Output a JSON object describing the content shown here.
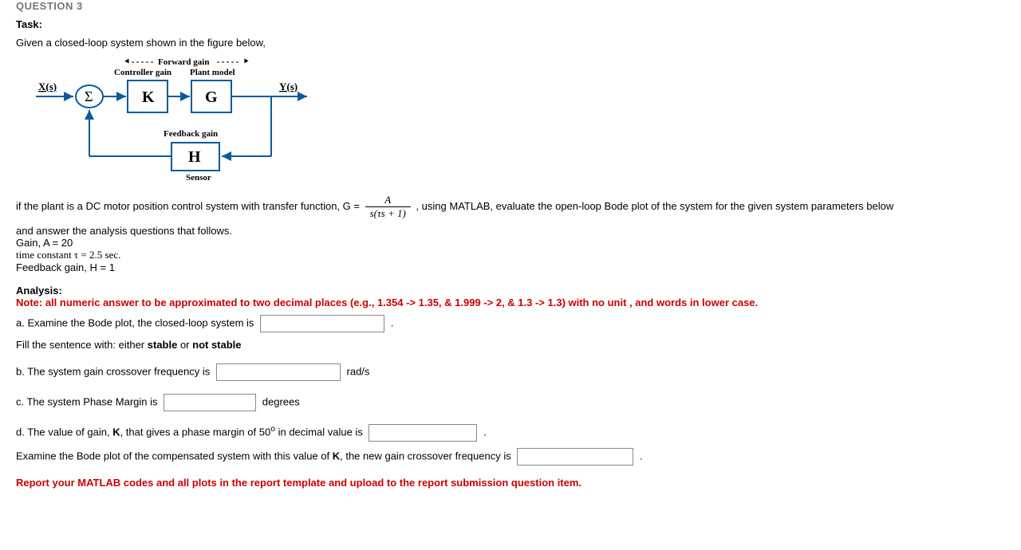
{
  "header": {
    "question_label": "QUESTION 3",
    "task_label": "Task:",
    "task_text": "Given a closed-loop system shown in the figure below,"
  },
  "diagram": {
    "forward_gain_label": "Forward gain",
    "controller_gain_label": "Controller gain",
    "plant_model_label": "Plant model",
    "feedback_gain_label": "Feedback gain",
    "sensor_label": "Sensor",
    "input_label": "X(s)",
    "output_label": "Y(s)",
    "sum_symbol": "Σ",
    "k_label": "K",
    "g_label": "G",
    "h_label": "H"
  },
  "transfer": {
    "pre_text": "if the plant is a DC motor position control system with  transfer function, G =",
    "numerator": "A",
    "denominator": "s(τs + 1)",
    "post_text": ",   using MATLAB, evaluate the open-loop Bode plot of the system for the given system parameters below"
  },
  "params": {
    "line1": "and  answer the analysis questions that follows.",
    "line2": "Gain, A = 20",
    "line3": "time constant τ = 2.5 sec.",
    "line4": "Feedback gain, H = 1"
  },
  "analysis": {
    "analysis_label": "Analysis:",
    "note": "Note: all numeric answer to be approximated to  two decimal places (e.g., 1.354 -> 1.35, & 1.999 -> 2, & 1.3 -> 1.3) with no unit , and words in lower case.",
    "a_pre": "a. Examine the Bode plot, the closed-loop system is",
    "a_post": ".",
    "a_fill": "Fill the sentence with: either ",
    "a_stable": "stable",
    "a_or": " or ",
    "a_notstable": "not stable",
    "b_pre": "b. The system gain crossover frequency is",
    "b_unit": "rad/s",
    "c_pre": "c. The system Phase Margin is",
    "c_unit": "degrees",
    "d_pre_1": "d. The value of gain, ",
    "d_k": "K",
    "d_pre_2": ",  that gives a phase margin of 50",
    "d_sup": "o",
    "d_pre_3": "  in decimal value is",
    "d_post": ".",
    "d2_pre_1": "Examine the Bode plot of the compensated system with this value of ",
    "d2_k": "K",
    "d2_pre_2": ", the new gain crossover frequency is",
    "d2_post": ".",
    "report": "Report your MATLAB codes and all plots in the report template and upload to the report submission question item."
  }
}
